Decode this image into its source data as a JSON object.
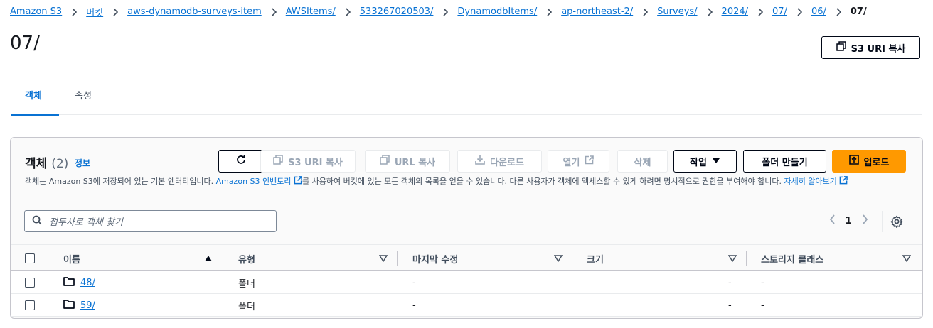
{
  "breadcrumbs": [
    "Amazon S3",
    "버킷",
    "aws-dynamodb-surveys-item",
    "AWSItems/",
    "533267020503/",
    "DynamodbItems/",
    "ap-northeast-2/",
    "Surveys/",
    "2024/",
    "07/",
    "06/",
    "07/"
  ],
  "page_title": "07/",
  "copy_uri_top": "S3 URI 복사",
  "tabs": {
    "objects": "객체",
    "properties": "속성"
  },
  "panel": {
    "title": "객체",
    "count": "(2)",
    "info": "정보",
    "desc_1": "객체는 Amazon S3에 저장되어 있는 기본 엔터티입니다. ",
    "desc_link": "Amazon S3 인벤토리",
    "desc_2": "를 사용하여 버킷에 있는 모든 객체의 목록을 얻을 수 있습니다. 다른 사용자가 객체에 액세스할 수 있게 하려면 명시적으로 권한을 부여해야 합니다. ",
    "desc_learn": "자세히 알아보기"
  },
  "toolbar": {
    "copy_uri": "S3 URI 복사",
    "copy_url": "URL 복사",
    "download": "다운로드",
    "open": "열기",
    "delete": "삭제",
    "actions": "작업",
    "create_folder": "폴더 만들기",
    "upload": "업로드"
  },
  "search": {
    "placeholder": "접두사로 객체 찾기"
  },
  "pagination": {
    "current_page": "1"
  },
  "table": {
    "headers": {
      "name": "이름",
      "type": "유형",
      "modified": "마지막 수정",
      "size": "크기",
      "storage": "스토리지 클래스"
    },
    "rows": [
      {
        "name": "48/",
        "type": "폴더",
        "modified": "-",
        "size": "-",
        "storage": "-"
      },
      {
        "name": "59/",
        "type": "폴더",
        "modified": "-",
        "size": "-",
        "storage": "-"
      }
    ]
  },
  "colors": {
    "link": "#0972d3",
    "primary_button": "#ff9900",
    "text": "#16191f"
  }
}
